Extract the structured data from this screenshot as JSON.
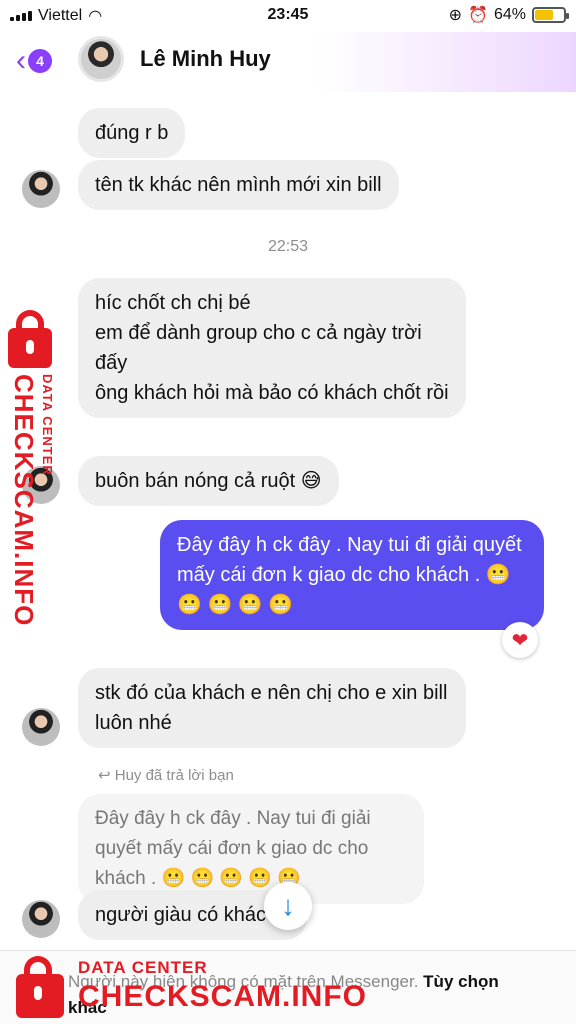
{
  "status_bar": {
    "carrier": "Viettel",
    "time": "23:45",
    "battery": "64%",
    "battery_level": 0.64
  },
  "header": {
    "back_count": "4",
    "name": "Lê Minh Huy"
  },
  "messages": {
    "m1": "đúng r b",
    "m2": "tên tk khác nên mình mới xin bill",
    "timestamp": "22:53",
    "m3": "híc chốt ch chị bé\nem để dành group cho c cả ngày trời đấy\nông khách hỏi mà bảo có khách chốt rồi",
    "m4": "buôn bán nóng cả ruột 😅",
    "m5_out": "Đây đây h ck đây . Nay tui đi giải quyết mấy cái đơn k giao dc cho khách  . 😬 😬 😬 😬 😬",
    "m6": "stk đó của khách e nên chị cho e xin bill luôn nhé",
    "reply_label": "↩ Huy đã trả lời bạn",
    "quote": "Đây đây h ck đây . Nay tui đi giải quyết mấy cái đơn k giao dc cho khách  . 😬 😬 😬 😬 😬",
    "m7": "người giàu có khác :))"
  },
  "reaction": "❤",
  "footer": {
    "notice": "Người này hiện không có mặt trên Messenger.",
    "action": "Tùy chọn khác"
  },
  "watermark": {
    "line1": "DATA CENTER",
    "line2": "CHECKSCAM.INFO"
  },
  "colors": {
    "accent": "#8a3ffc",
    "outgoing": "#5b4ef0",
    "incoming": "#eeeeee",
    "watermark": "#e31b23"
  }
}
